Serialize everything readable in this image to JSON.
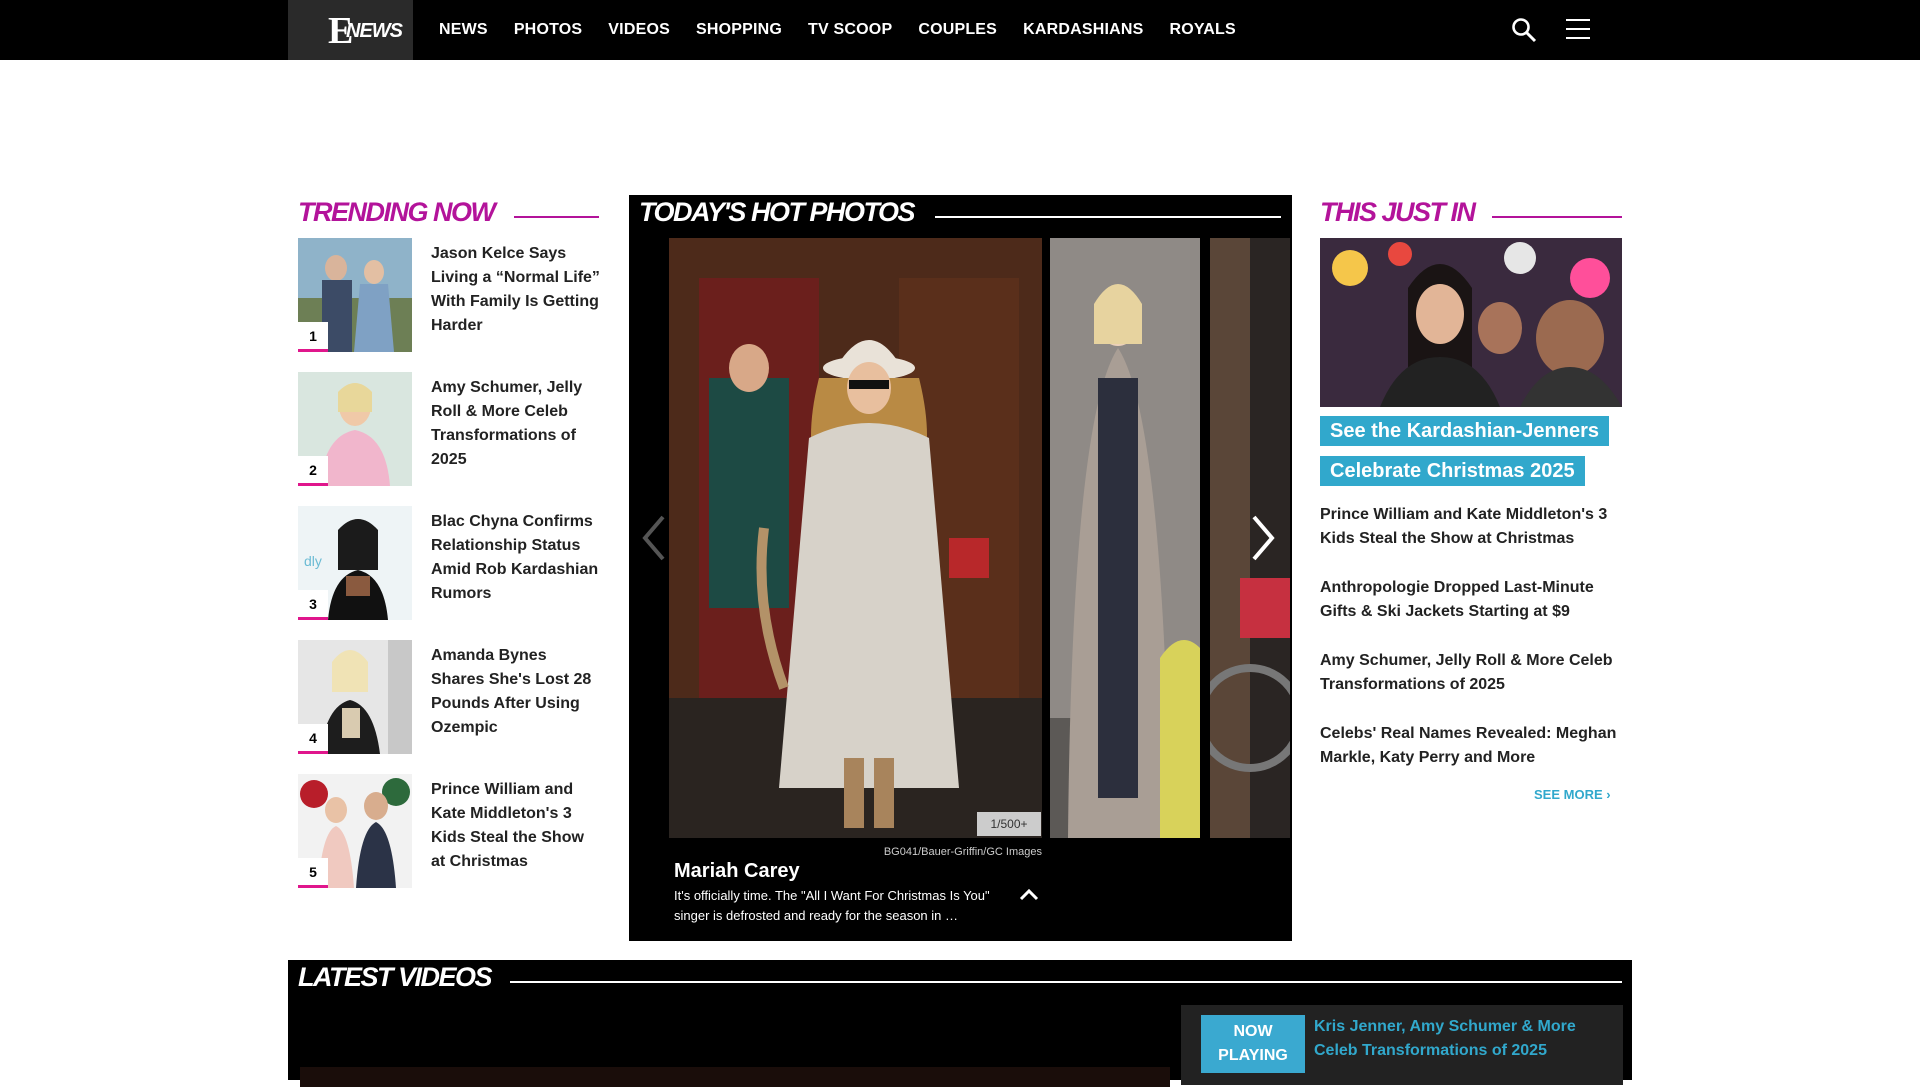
{
  "brand": {
    "logo_letter": "E",
    "logo_word": "NEWS"
  },
  "nav": {
    "items": [
      {
        "label": "NEWS"
      },
      {
        "label": "PHOTOS"
      },
      {
        "label": "VIDEOS"
      },
      {
        "label": "SHOPPING"
      },
      {
        "label": "TV SCOOP"
      },
      {
        "label": "COUPLES"
      },
      {
        "label": "KARDASHIANS"
      },
      {
        "label": "ROYALS"
      }
    ],
    "search_icon": "search-icon",
    "menu_icon": "hamburger-menu-icon"
  },
  "trending": {
    "heading": "TRENDING NOW",
    "accent": "#b3139a",
    "items": [
      {
        "rank": "1",
        "title": "Jason Kelce Says Living a “Normal Life” With Family Is Getting Harder"
      },
      {
        "rank": "2",
        "title": "Amy Schumer, Jelly Roll & More Celeb Transformations of 2025"
      },
      {
        "rank": "3",
        "title": "Blac Chyna Confirms Relationship Status Amid Rob Kardashian Rumors"
      },
      {
        "rank": "4",
        "title": "Amanda Bynes Shares She's Lost 28 Pounds After Using Ozempic"
      },
      {
        "rank": "5",
        "title": "Prince William and Kate Middleton's 3 Kids Steal the Show at Christmas"
      }
    ]
  },
  "hot_photos": {
    "heading": "TODAY'S HOT PHOTOS",
    "counter": "1/500+",
    "credit": "BG041/Bauer-Griffin/GC Images",
    "name": "Mariah Carey",
    "caption": "It's officially time. The \"All I Want For Christmas Is You\" singer is defrosted and ready for the season in …"
  },
  "just_in": {
    "heading": "THIS JUST IN",
    "feature_title": "See the Kardashian-Jenners Celebrate Christmas 2025",
    "items": [
      {
        "title": "Prince William and Kate Middleton's 3 Kids Steal the Show at Christmas"
      },
      {
        "title": "Anthropologie Dropped Last-Minute Gifts & Ski Jackets Starting at $9"
      },
      {
        "title": "Amy Schumer, Jelly Roll & More Celeb Transformations of 2025"
      },
      {
        "title": "Celebs' Real Names Revealed: Meghan Markle, Katy Perry and More"
      }
    ],
    "see_more": "SEE MORE"
  },
  "latest_videos": {
    "heading": "LATEST VIDEOS",
    "now_playing_label": "NOW PLAYING",
    "now_playing_title": "Kris Jenner, Amy Schumer & More Celeb Transformations of 2025"
  },
  "colors": {
    "nav_bg": "#000000",
    "logo_bg": "#2a2a2a",
    "magenta": "#b3139a",
    "cyan": "#31a8cc"
  }
}
